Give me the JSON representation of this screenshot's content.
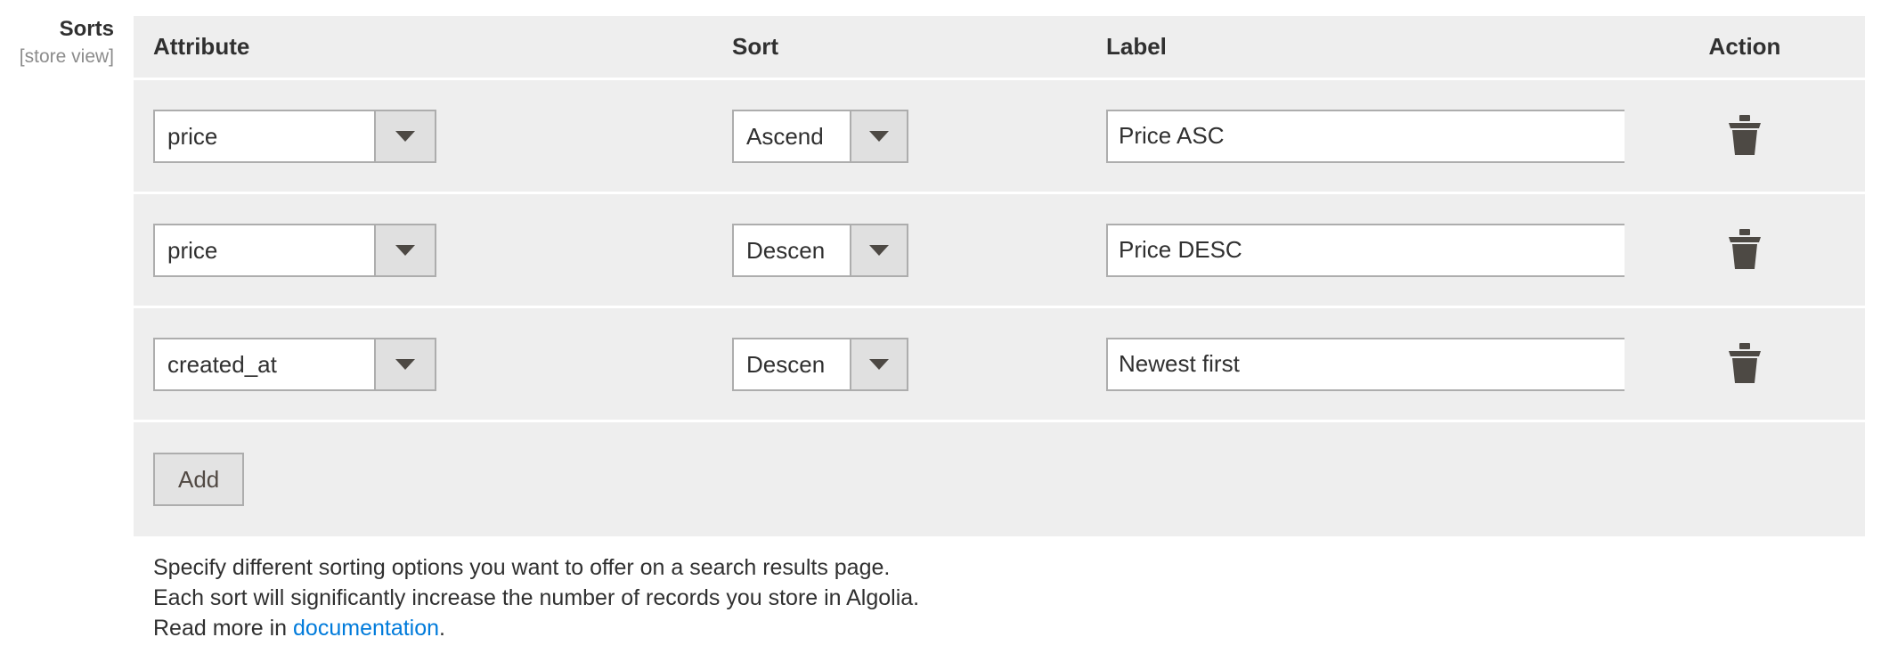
{
  "field": {
    "label": "Sorts",
    "scope": "[store view]"
  },
  "table": {
    "headers": {
      "attribute": "Attribute",
      "sort": "Sort",
      "label": "Label",
      "action": "Action"
    },
    "rows": [
      {
        "attribute": "price",
        "sort": "Ascend",
        "label_value": "Price ASC",
        "delete_icon": "trash-icon"
      },
      {
        "attribute": "price",
        "sort": "Descen",
        "label_value": "Price DESC",
        "delete_icon": "trash-icon"
      },
      {
        "attribute": "created_at",
        "sort": "Descen",
        "label_value": "Newest first",
        "delete_icon": "trash-icon"
      }
    ],
    "add_button": "Add"
  },
  "note": {
    "line1": "Specify different sorting options you want to offer on a search results page.",
    "line2": "Each sort will significantly increase the number of records you store in Algolia.",
    "line3_prefix": "Read more in ",
    "link_text": "documentation",
    "line3_suffix": "."
  },
  "colors": {
    "row_background": "#eeeeee",
    "link": "#007bdb",
    "border": "#adadad",
    "text": "#303030",
    "scope_text": "#8c8c8c"
  }
}
